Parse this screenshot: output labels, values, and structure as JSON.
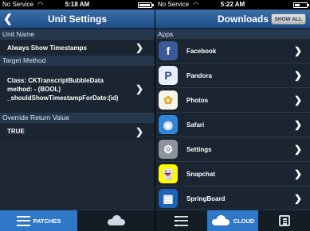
{
  "left": {
    "status": {
      "carrier": "No Service",
      "time": "5:18 AM"
    },
    "nav": {
      "title": "Unit Settings",
      "back_glyph": "❮"
    },
    "sections": [
      {
        "header": "Unit Name",
        "value": "Always Show Timestamps"
      },
      {
        "header": "Target Method",
        "value": "Class: CKTranscriptBubbleData method: - (BOOL) _shouldShowTimestampForDate:(id)"
      },
      {
        "header": "Override Return Value",
        "value": "TRUE"
      }
    ],
    "tabs": [
      {
        "label": "PATCHES"
      },
      {
        "label": ""
      }
    ]
  },
  "right": {
    "status": {
      "carrier": "No Service",
      "time": "5:22 AM"
    },
    "nav": {
      "title": "Downloads",
      "show_all": "SHOW ALL"
    },
    "section_header": "Apps",
    "apps": [
      {
        "label": "Facebook",
        "icon": "facebook-icon",
        "glyph": "f",
        "color": "#3b5998"
      },
      {
        "label": "Pandora",
        "icon": "pandora-icon",
        "glyph": "P",
        "color": "#e8eef5"
      },
      {
        "label": "Photos",
        "icon": "photos-icon",
        "glyph": "✿",
        "color": "#f6f3e8"
      },
      {
        "label": "Safari",
        "icon": "safari-icon",
        "glyph": "◉",
        "color": "#2f86d6"
      },
      {
        "label": "Settings",
        "icon": "settings-icon",
        "glyph": "⚙",
        "color": "#8d939a"
      },
      {
        "label": "Snapchat",
        "icon": "snapchat-icon",
        "glyph": "👻",
        "color": "#fffc00"
      },
      {
        "label": "SpringBoard",
        "icon": "springboard-icon",
        "glyph": "▦",
        "color": "#1d64b8"
      }
    ],
    "tabs": [
      {
        "label": ""
      },
      {
        "label": "CLOUD"
      },
      {
        "label": ""
      }
    ]
  },
  "chevron": "❯"
}
